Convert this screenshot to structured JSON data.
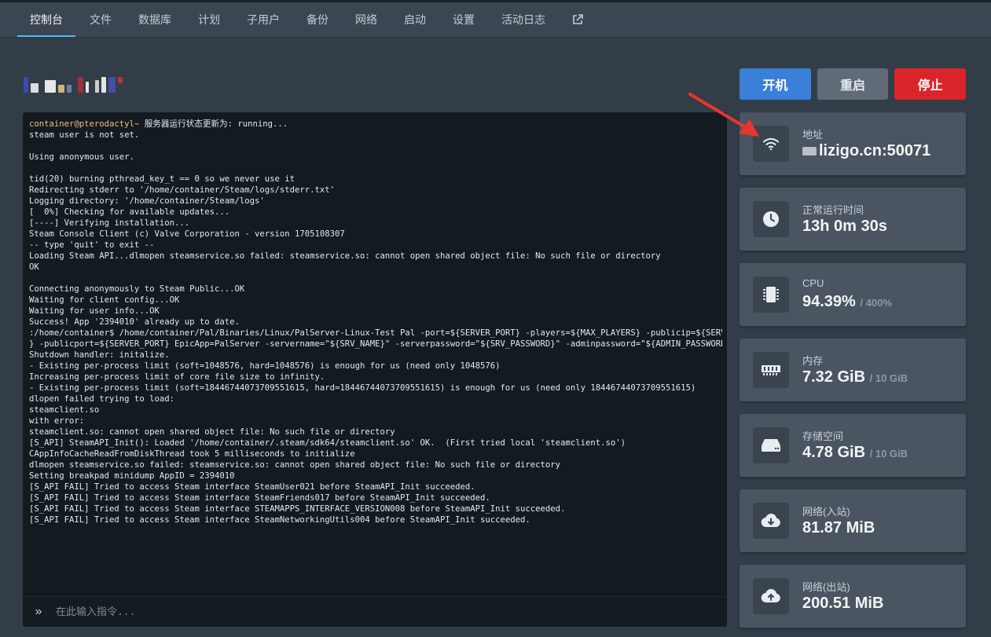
{
  "nav": {
    "items": [
      "控制台",
      "文件",
      "数据库",
      "计划",
      "子用户",
      "备份",
      "网络",
      "启动",
      "设置",
      "活动日志"
    ],
    "active_index": 0,
    "external_link_icon": "external-link-icon"
  },
  "console": {
    "prompt_prefix": "container@pterodactyl~",
    "first_line_text": " 服务器运行状态更新为: running...",
    "lines": [
      "steam user is not set.",
      "",
      "Using anonymous user.",
      "",
      "tid(20) burning pthread_key_t == 0 so we never use it",
      "Redirecting stderr to '/home/container/Steam/logs/stderr.txt'",
      "Logging directory: '/home/container/Steam/logs'",
      "[  0%] Checking for available updates...",
      "[----] Verifying installation...",
      "Steam Console Client (c) Valve Corporation - version 1705108307",
      "-- type 'quit' to exit --",
      "Loading Steam API...dlmopen steamservice.so failed: steamservice.so: cannot open shared object file: No such file or directory",
      "OK",
      "",
      "Connecting anonymously to Steam Public...OK",
      "Waiting for client config...OK",
      "Waiting for user info...OK",
      "Success! App '2394010' already up to date.",
      ":/home/container$ /home/container/Pal/Binaries/Linux/PalServer-Linux-Test Pal -port=${SERVER_PORT} -players=${MAX_PLAYERS} -publicip=${SERVER_IP",
      "} -publicport=${SERVER_PORT} EpicApp=PalServer -servername=\"${SRV_NAME}\" -serverpassword=\"${SRV_PASSWORD}\" -adminpassword=\"${ADMIN_PASSWORD}\"",
      "Shutdown handler: initalize.",
      "- Existing per-process limit (soft=1048576, hard=1048576) is enough for us (need only 1048576)",
      "Increasing per-process limit of core file size to infinity.",
      "- Existing per-process limit (soft=18446744073709551615, hard=18446744073709551615) is enough for us (need only 18446744073709551615)",
      "dlopen failed trying to load:",
      "steamclient.so",
      "with error:",
      "steamclient.so: cannot open shared object file: No such file or directory",
      "[S_API] SteamAPI_Init(): Loaded '/home/container/.steam/sdk64/steamclient.so' OK.  (First tried local 'steamclient.so')",
      "CAppInfoCacheReadFromDiskThread took 5 milliseconds to initialize",
      "dlmopen steamservice.so failed: steamservice.so: cannot open shared object file: No such file or directory",
      "Setting breakpad minidump AppID = 2394010",
      "[S_API FAIL] Tried to access Steam interface SteamUser021 before SteamAPI_Init succeeded.",
      "[S_API FAIL] Tried to access Steam interface SteamFriends017 before SteamAPI_Init succeeded.",
      "[S_API FAIL] Tried to access Steam interface STEAMAPPS_INTERFACE_VERSION008 before SteamAPI_Init succeeded.",
      "[S_API FAIL] Tried to access Steam interface SteamNetworkingUtils004 before SteamAPI_Init succeeded."
    ],
    "input_prompt": "»",
    "input_placeholder": "在此输入指令..."
  },
  "actions": {
    "start": "开机",
    "restart": "重启",
    "stop": "停止"
  },
  "stats": {
    "address": {
      "label": "地址",
      "value": "lizigo.cn:50071",
      "icon": "wifi-icon"
    },
    "uptime": {
      "label": "常运行时间",
      "label_prefix": "正",
      "value": "13h 0m 30s",
      "icon": "clock-icon"
    },
    "cpu": {
      "label": "CPU",
      "value": "94.39%",
      "limit": "/ 400%",
      "icon": "cpu-chip-icon"
    },
    "memory": {
      "label": "内存",
      "value": "7.32 GiB",
      "limit": "/ 10 GiB",
      "icon": "memory-icon"
    },
    "storage": {
      "label": "存储空间",
      "value": "4.78 GiB",
      "limit": "/ 10 GiB",
      "icon": "hard-drive-icon"
    },
    "net_in": {
      "label": "网络(入站)",
      "value": "81.87 MiB",
      "icon": "cloud-download-icon"
    },
    "net_out": {
      "label": "网络(出站)",
      "value": "200.51 MiB",
      "icon": "cloud-upload-icon"
    }
  },
  "colors": {
    "accent": "#57b8ff",
    "start_button": "#3a7fd8",
    "restart_button": "#5f6b77",
    "stop_button": "#d9252a",
    "console_prefix": "#f0c274",
    "annotation_arrow": "#e8362b"
  }
}
